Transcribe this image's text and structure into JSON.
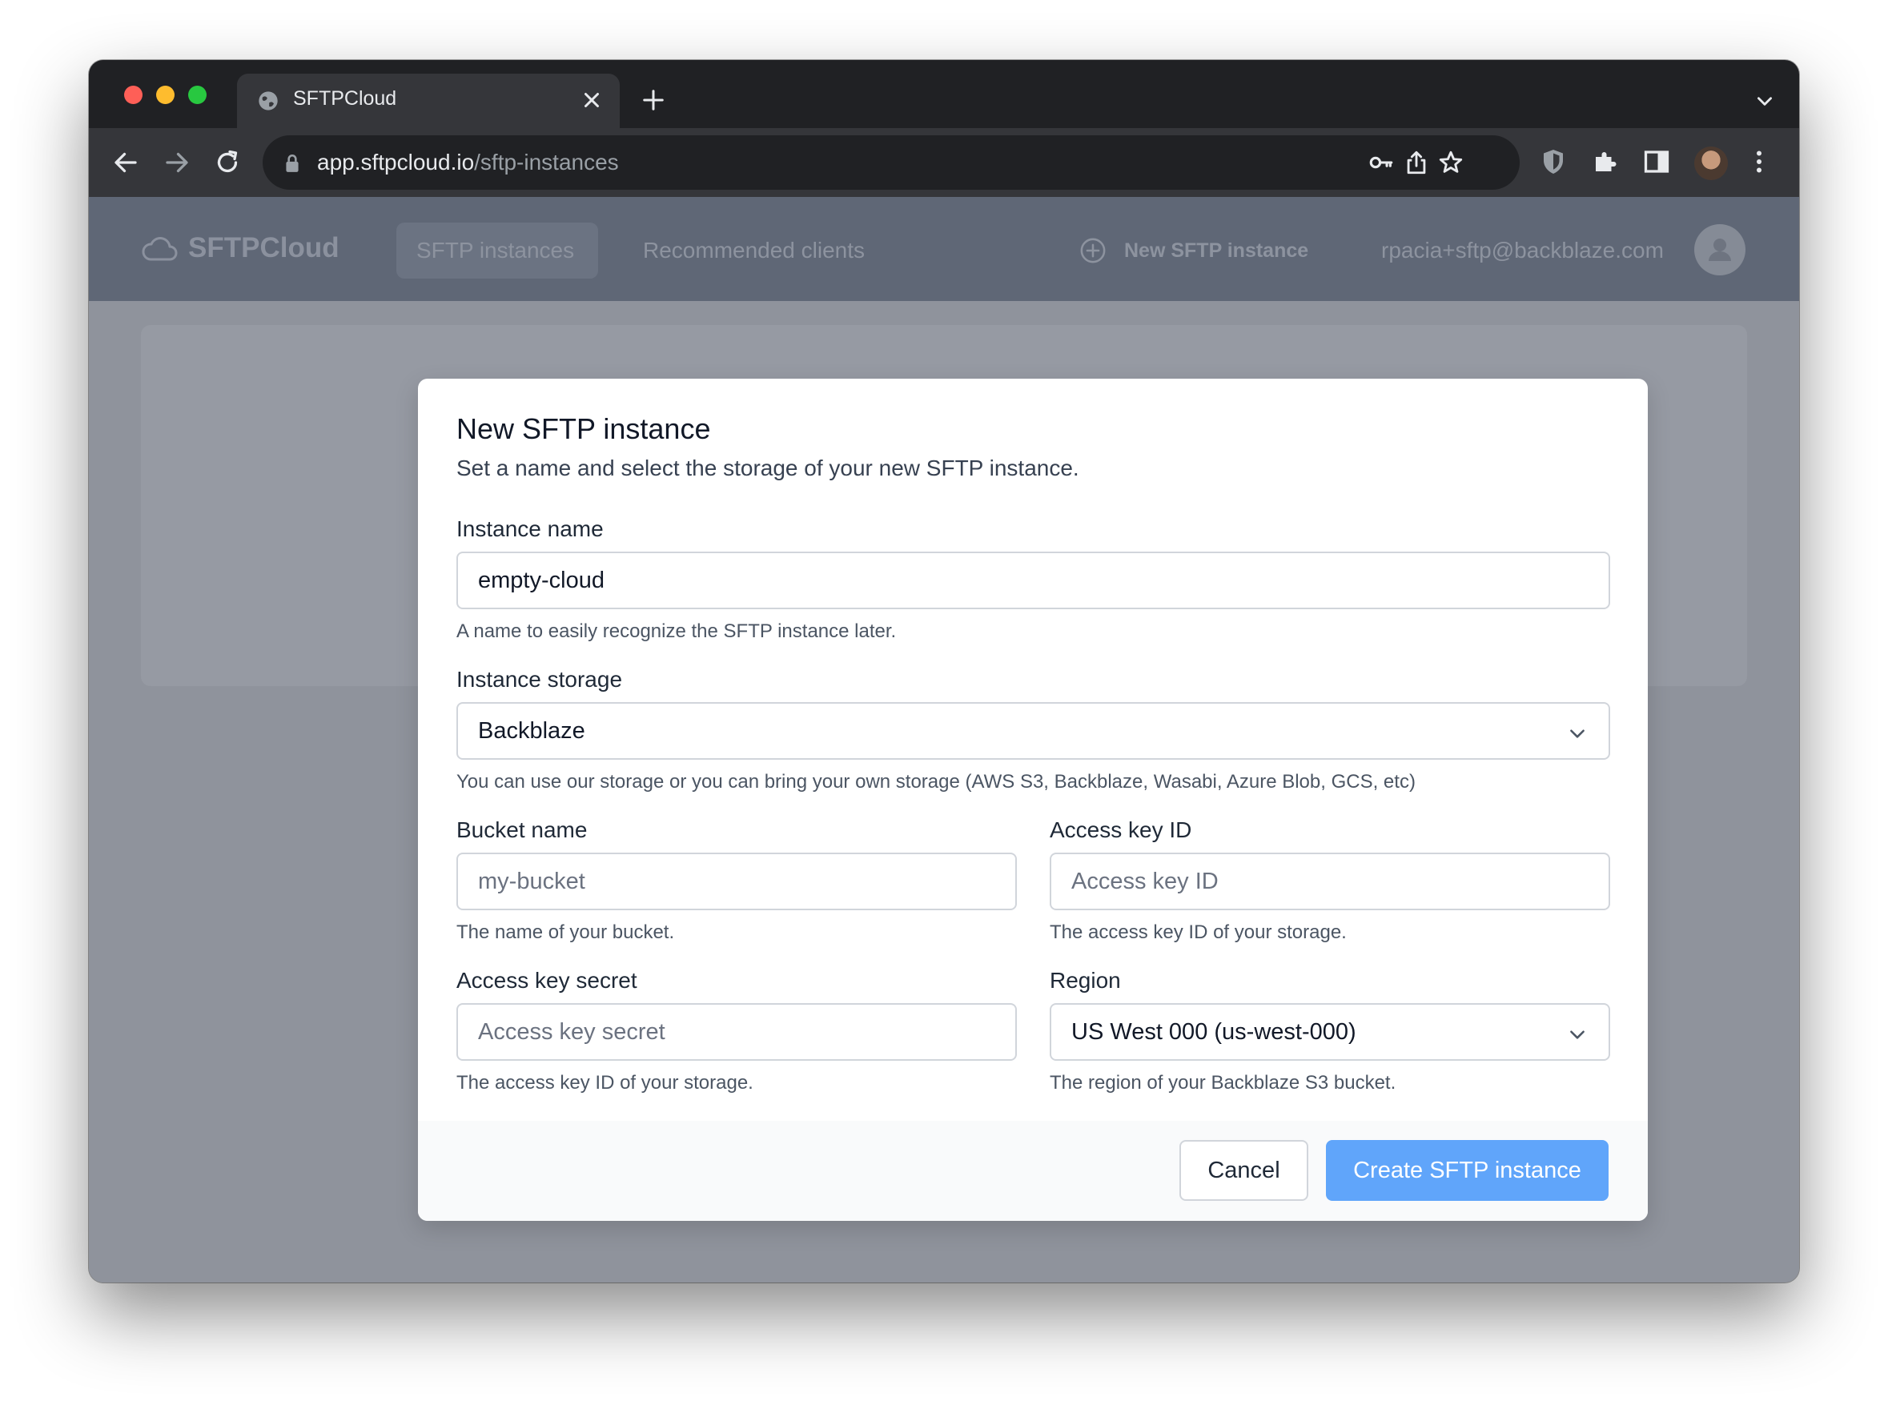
{
  "browser": {
    "tab_title": "SFTPCloud",
    "url_domain": "app.sftpcloud.io",
    "url_path": "/sftp-instances"
  },
  "app_nav": {
    "brand": "SFTPCloud",
    "items": [
      {
        "label": "SFTP instances"
      },
      {
        "label": "Recommended clients"
      }
    ],
    "new_instance_label": "New SFTP instance",
    "user_email": "rpacia+sftp@backblaze.com"
  },
  "modal": {
    "title": "New SFTP instance",
    "subtitle": "Set a name and select the storage of your new SFTP instance.",
    "instance_name": {
      "label": "Instance name",
      "value": "empty-cloud",
      "help": "A name to easily recognize the SFTP instance later."
    },
    "instance_storage": {
      "label": "Instance storage",
      "value": "Backblaze",
      "help": "You can use our storage or you can bring your own storage (AWS S3, Backblaze, Wasabi, Azure Blob, GCS, etc)"
    },
    "bucket_name": {
      "label": "Bucket name",
      "placeholder": "my-bucket",
      "help": "The name of your bucket."
    },
    "access_key_id": {
      "label": "Access key ID",
      "placeholder": "Access key ID",
      "help": "The access key ID of your storage."
    },
    "access_key_secret": {
      "label": "Access key secret",
      "placeholder": "Access key secret",
      "help": "The access key ID of your storage."
    },
    "region": {
      "label": "Region",
      "value": "US West 000 (us-west-000)",
      "help": "The region of your Backblaze S3 bucket."
    },
    "cancel_label": "Cancel",
    "create_label": "Create SFTP instance"
  },
  "colors": {
    "accent": "#60a5fa",
    "chat_button": "#3478f6",
    "nav_bg": "#5f6776"
  }
}
